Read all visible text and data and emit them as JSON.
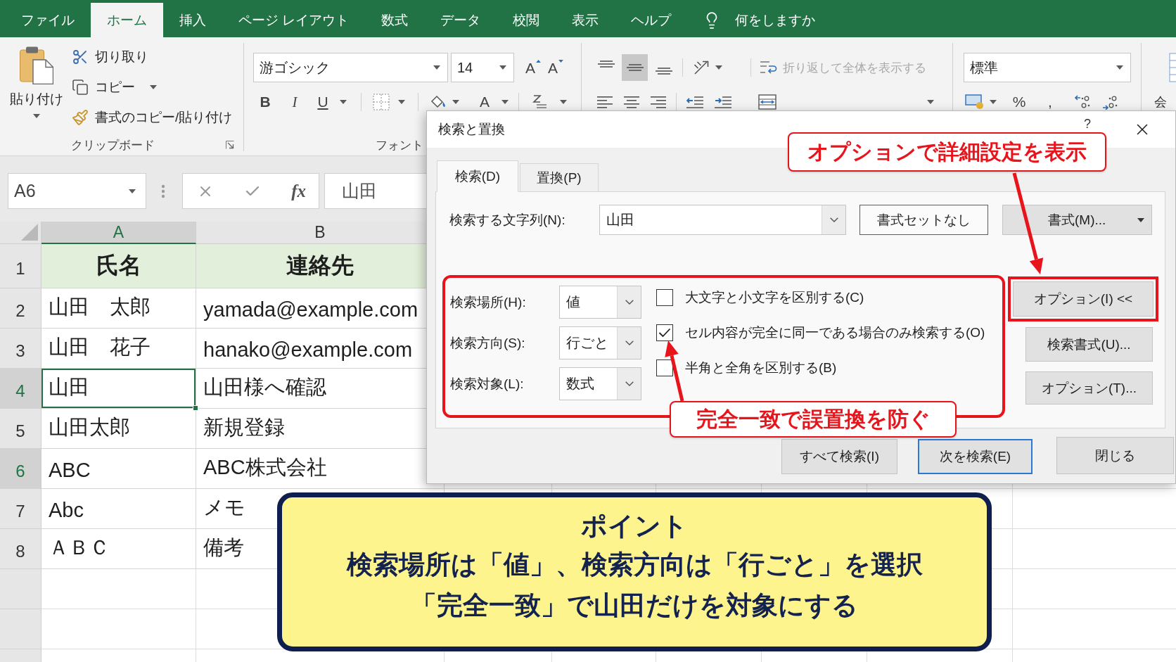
{
  "menu_bar": {
    "tabs": [
      {
        "label": "ファイル",
        "selected": false
      },
      {
        "label": "ホーム",
        "selected": true
      },
      {
        "label": "挿入",
        "selected": false
      },
      {
        "label": "ページ レイアウト",
        "selected": false
      },
      {
        "label": "数式",
        "selected": false
      },
      {
        "label": "データ",
        "selected": false
      },
      {
        "label": "校閲",
        "selected": false
      },
      {
        "label": "表示",
        "selected": false
      },
      {
        "label": "ヘルプ",
        "selected": false
      }
    ],
    "tell_me": "何をしますか"
  },
  "ribbon": {
    "clipboard": {
      "paste": "貼り付け",
      "cut": "切り取り",
      "copy": "コピー",
      "format_painter": "書式のコピー/貼り付け",
      "group_label": "クリップボード"
    },
    "font": {
      "font_name": "游ゴシック",
      "font_size": "14",
      "grow_font": "A",
      "shrink_font": "A",
      "bold": "B",
      "italic": "I",
      "underline": "U",
      "font_color": "A",
      "group_label": "フォント"
    },
    "alignment": {
      "vertical_buttons": [
        {
          "selected": false
        },
        {
          "selected": true
        },
        {
          "selected": false
        }
      ],
      "wrap_text": {
        "label": "折り返して全体を表示する",
        "disabled": true
      }
    },
    "number": {
      "format": "標準",
      "percent": "%",
      "comma": ","
    },
    "styles": {
      "label": "会"
    }
  },
  "formula_bar": {
    "name_box": "A6",
    "function_label": "fx",
    "value": "山田"
  },
  "sheet": {
    "columns": [
      {
        "label": "A",
        "selected": true
      },
      {
        "label": "B",
        "selected": false
      }
    ],
    "rows": [
      {
        "number": "1",
        "selected": false,
        "kind": "header",
        "cells": [
          {
            "text": "氏名",
            "active": false
          },
          {
            "text": "連絡先",
            "active": false
          }
        ]
      },
      {
        "number": "2",
        "selected": false,
        "kind": "data",
        "cells": [
          {
            "text": "山田　太郎",
            "active": false
          },
          {
            "text": "yamada@example.com",
            "active": false
          }
        ]
      },
      {
        "number": "3",
        "selected": false,
        "kind": "data",
        "cells": [
          {
            "text": "山田　花子",
            "active": false
          },
          {
            "text": "hanako@example.com",
            "active": false
          }
        ]
      },
      {
        "number": "4",
        "selected": true,
        "kind": "data",
        "cells": [
          {
            "text": "山田",
            "active": true
          },
          {
            "text": "山田様へ確認",
            "active": false
          }
        ]
      },
      {
        "number": "5",
        "selected": false,
        "kind": "data",
        "cells": [
          {
            "text": "山田太郎",
            "active": false
          },
          {
            "text": "新規登録",
            "active": false
          }
        ]
      },
      {
        "number": "6",
        "selected": true,
        "kind": "data",
        "cells": [
          {
            "text": "ABC",
            "active": false
          },
          {
            "text": "ABC株式会社",
            "active": false
          }
        ]
      },
      {
        "number": "7",
        "selected": false,
        "kind": "data",
        "cells": [
          {
            "text": "Abc",
            "active": false
          },
          {
            "text": "メモ",
            "active": false
          }
        ]
      },
      {
        "number": "8",
        "selected": false,
        "kind": "data",
        "cells": [
          {
            "text": "ＡＢＣ",
            "active": false
          },
          {
            "text": "備考",
            "active": false
          }
        ]
      }
    ]
  },
  "dialog": {
    "title": "検索と置換",
    "help": "?",
    "tabs": [
      {
        "label": "検索(D)",
        "selected": true
      },
      {
        "label": "置換(P)",
        "selected": false
      }
    ],
    "find": {
      "label": "検索する文字列(N):",
      "value": "山田"
    },
    "format_preview": "書式セットなし",
    "format_button": "書式(M)...",
    "options": {
      "highlighted": true,
      "fields": [
        {
          "label": "検索場所(H):",
          "value": "値"
        },
        {
          "label": "検索方向(S):",
          "value": "行ごと"
        },
        {
          "label": "検索対象(L):",
          "value": "数式"
        }
      ],
      "checkboxes": [
        {
          "label": "大文字と小文字を区別する(C)",
          "checked": false
        },
        {
          "label": "セル内容が完全に同一である場合のみ検索する(O)",
          "checked": true
        },
        {
          "label": "半角と全角を区別する(B)",
          "checked": false
        }
      ]
    },
    "side_buttons": [
      {
        "label": "オプション(I) <<",
        "highlighted": true
      },
      {
        "label": "検索書式(U)...",
        "highlighted": false
      },
      {
        "label": "オプション(T)...",
        "highlighted": false
      }
    ],
    "bottom_buttons": [
      {
        "label": "すべて検索(I)",
        "default": false
      },
      {
        "label": "次を検索(E)",
        "default": true
      },
      {
        "label": "閉じる",
        "default": false
      }
    ]
  },
  "callouts": [
    {
      "text": "オプションで詳細設定を表示"
    },
    {
      "text": "完全一致で誤置換を防ぐ"
    }
  ],
  "point_box": {
    "title": "ポイント",
    "lines": [
      "検索場所は「値」、検索方向は「行ごと」を選択",
      "「完全一致」で山田だけを対象にする"
    ]
  }
}
